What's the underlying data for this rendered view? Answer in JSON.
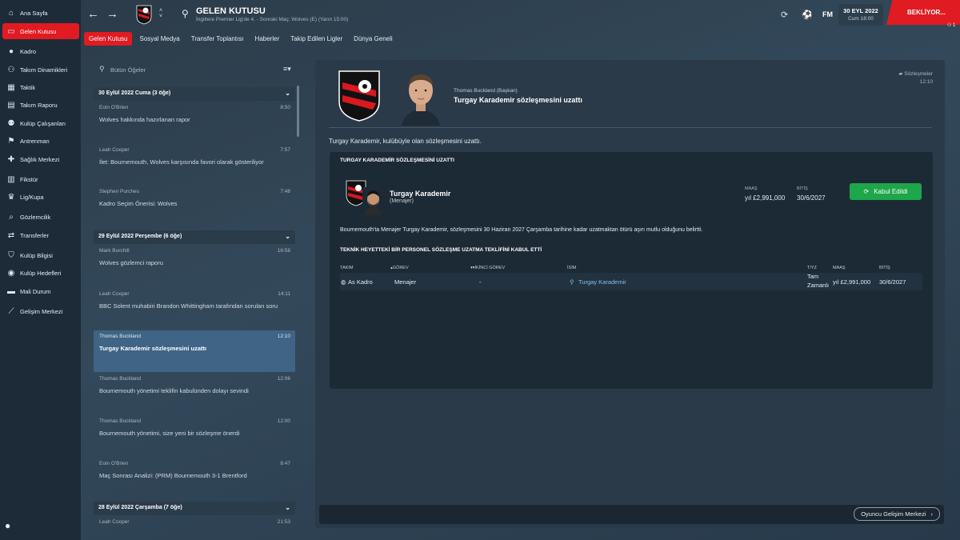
{
  "sidebar": {
    "items": [
      {
        "label": "Ana Sayfa",
        "icon": "home-icon",
        "glyph": "⌂"
      },
      {
        "label": "Gelen Kutusu",
        "icon": "inbox-icon",
        "glyph": "▭",
        "active": true
      },
      {
        "label": "Kadro",
        "icon": "squad-icon",
        "glyph": "●"
      },
      {
        "label": "Takım Dinamikleri",
        "icon": "dynamics-icon",
        "glyph": "⚇"
      },
      {
        "label": "Taktik",
        "icon": "tactics-icon",
        "glyph": "▦"
      },
      {
        "label": "Takım Raporu",
        "icon": "report-icon",
        "glyph": "▤"
      },
      {
        "label": "Kulüp Çalışanları",
        "icon": "staff-icon",
        "glyph": "⚉"
      },
      {
        "label": "Antrenman",
        "icon": "training-icon",
        "glyph": "⚑"
      },
      {
        "label": "Sağlık Merkezi",
        "icon": "medical-icon",
        "glyph": "✚"
      },
      {
        "label": "Fikstür",
        "icon": "fixtures-icon",
        "glyph": "▥"
      },
      {
        "label": "Lig/Kupa",
        "icon": "trophy-icon",
        "glyph": "♛"
      },
      {
        "label": "Gözlemcilik",
        "icon": "scouting-icon",
        "glyph": "⌕"
      },
      {
        "label": "Transferler",
        "icon": "transfers-icon",
        "glyph": "⇄"
      },
      {
        "label": "Kulüp Bilgisi",
        "icon": "club-info-icon",
        "glyph": "⛉"
      },
      {
        "label": "Kulüp Hedefleri",
        "icon": "club-vision-icon",
        "glyph": "◉"
      },
      {
        "label": "Mali Durum",
        "icon": "finances-icon",
        "glyph": "▬"
      },
      {
        "label": "Gelişim Merkezi",
        "icon": "development-icon",
        "glyph": "⟋"
      }
    ]
  },
  "topbar": {
    "title": "GELEN KUTUSU",
    "subtitle": "İngiltere Premier Lig'de 4. - Sonraki Maç: Wolves (E) (Yarın 15:00)",
    "fm_label": "FM",
    "date": "30 EYL 2022",
    "day_time": "Cum 18:00",
    "continue_label": "BEKLİYOR...",
    "notification_count": "1"
  },
  "tabs": [
    "Gelen Kutusu",
    "Sosyal Medya",
    "Transfer Toplantısı",
    "Haberler",
    "Takip Edilen Ligler",
    "Dünya Geneli"
  ],
  "inbox": {
    "search_placeholder": "Bütün Öğeler",
    "days": [
      {
        "label": "30 Eylül 2022 Cuma (3 öğe)"
      },
      {
        "label": "29 Eylül 2022 Perşembe (6 öğe)"
      },
      {
        "label": "28 Eylül 2022 Çarşamba (7 öğe)"
      }
    ],
    "messages": [
      {
        "sender": "Eoin O'Brien",
        "time": "8:50",
        "subject": "Wolves hakkında hazırlanan rapor"
      },
      {
        "sender": "Leah Cooper",
        "time": "7:57",
        "subject": "İlet: Bournemouth, Wolves karşısında favori olarak gösteriliyor"
      },
      {
        "sender": "Stephen Purches",
        "time": "7:48",
        "subject": "Kadro Seçim Önerisi: Wolves"
      },
      {
        "sender": "Mark Burchill",
        "time": "16:58",
        "subject": "Wolves gözlemci raporu"
      },
      {
        "sender": "Leah Cooper",
        "time": "14:11",
        "subject": "BBC Solent muhabiri Brandon Whittingham tarafından sorulan soru"
      },
      {
        "sender": "Thomas Buckland",
        "time": "12:10",
        "subject": "Turgay Karademir sözleşmesini uzattı",
        "selected": true
      },
      {
        "sender": "Thomas Buckland",
        "time": "12:06",
        "subject": "Bournemouth yönetimi teklifin kabulünden dolayı sevindi"
      },
      {
        "sender": "Thomas Buckland",
        "time": "12:00",
        "subject": "Bournemouth yönetimi, size yeni bir sözleşme önerdi"
      },
      {
        "sender": "Eoin O'Brien",
        "time": "8:47",
        "subject": "Maç Sonrası Analizi: (PRM) Bournemouth 3-1 Brentford"
      },
      {
        "sender": "Leah Cooper",
        "time": "21:53",
        "subject": ""
      }
    ]
  },
  "message": {
    "from": "Thomas Buckland  (Başkan)",
    "subject": "Turgay Karademir sözleşmesini uzattı",
    "category": "Sözleşmeler",
    "time": "12:10",
    "body": "Turgay Karademir, kulübüyle olan sözleşmesini uzattı.",
    "card_title": "TURGAY KARADEMİR SÖZLEŞMESİNİ UZATTI",
    "staff_name": "Turgay Karademir",
    "staff_role": "(Menajer)",
    "wage_label": "MAAŞ",
    "wage_value": "yıl £2,991,000",
    "expiry_label": "BİTİŞ",
    "expiry_value": "30/6/2027",
    "accepted_label": "Kabul Edildi",
    "paragraph": "Bournemouth'ta Menajer Turgay Karademir, sözleşmesini 30 Haziran 2027 Çarşamba tarihine kadar uzatmaktan ötürü aşırı mutlu olduğunu belirtti.",
    "section_title": "TEKNİK HEYETTEKİ BİR PERSONEL SÖZLEŞME UZATMA TEKLİFİNİ KABUL ETTİ",
    "table": {
      "headers": {
        "team": "TAKIM",
        "role": "GÖREV",
        "second_role": "İKİNCİ GÖREV",
        "name": "İSİM",
        "type": "T/YZ",
        "wage": "MAAŞ",
        "expiry": "BİTİŞ"
      },
      "row": {
        "team": "As Kadro",
        "role": "Menajer",
        "second_role": "-",
        "name": "Turgay Karademir",
        "type_line1": "Tam",
        "type_line2": "Zamanlı",
        "wage": "yıl £2,991,000",
        "expiry": "30/6/2027"
      }
    }
  },
  "footer": {
    "dev_button": "Oyuncu Gelişim Merkezi"
  },
  "colors": {
    "accent": "#e11b22",
    "selected": "#3f6485",
    "accepted": "#1ea64a",
    "sidebar": "#1d2b38"
  }
}
